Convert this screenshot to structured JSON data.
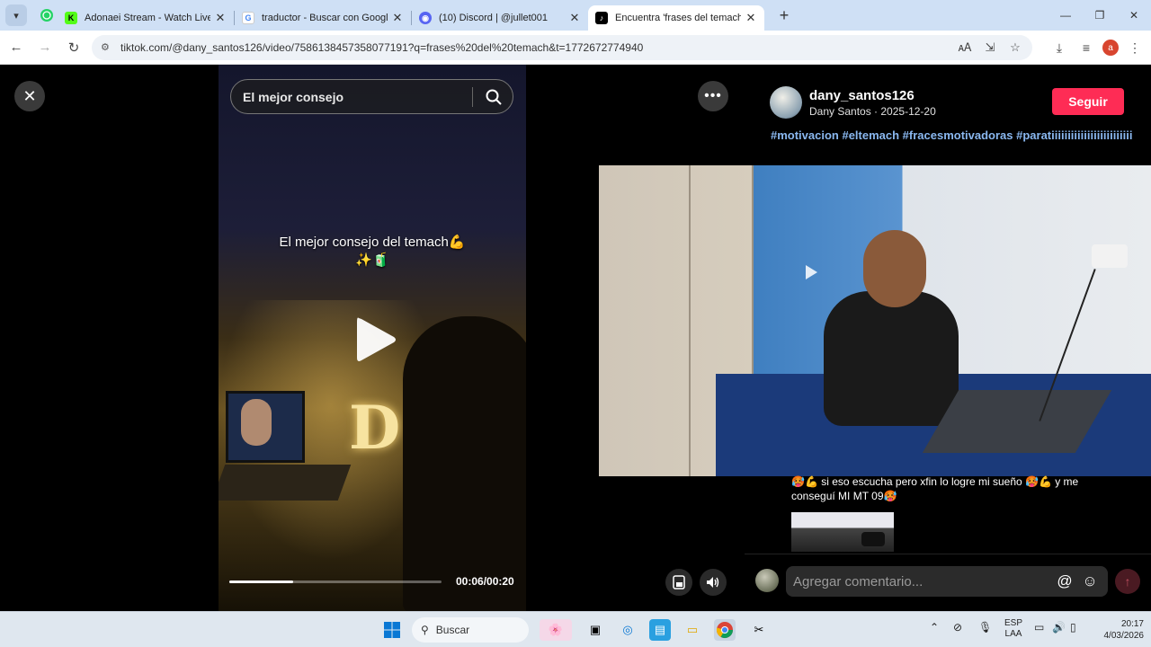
{
  "browser": {
    "tabs": [
      {
        "title": "Adonaei Stream - Watch Live o",
        "favicon": "kick-icon",
        "color": "#53fc18",
        "active": false
      },
      {
        "title": "traductor - Buscar con Google",
        "favicon": "google-icon",
        "color": "#4285f4",
        "active": false
      },
      {
        "title": "(10) Discord | @jullet001",
        "favicon": "discord-icon",
        "color": "#5865f2",
        "active": false
      },
      {
        "title": "Encuentra 'frases del temach' e",
        "favicon": "tiktok-icon",
        "color": "#000000",
        "active": true
      }
    ],
    "url": "tiktok.com/@dany_santos126/video/7586138457358077191?q=frases%20del%20temach&t=1772672774940"
  },
  "video": {
    "search_value": "El mejor consejo",
    "caption": "El mejor consejo del temach💪✨🧃",
    "time": "00:06/00:20",
    "progress": 0.3
  },
  "post": {
    "handle": "dany_santos126",
    "subline": "Dany Santos · 2025-12-20",
    "follow_label": "Seguir",
    "hashtags": "#motivacion #eltemach #fracesmotivadoras #paratiiiiiiiiiiiiiiiiiiiiiiiii",
    "accent": "#fe2c55"
  },
  "comments": {
    "item_text": "🥵💪 si eso escucha pero xfin lo logre mi sueño 🥵💪 y me conseguí MI MT 09🥵",
    "input_placeholder": "Agregar comentario..."
  },
  "taskbar": {
    "search_label": "Buscar",
    "lang_line1": "ESP",
    "lang_line2": "LAA",
    "time": "20:17",
    "date": "4/03/2026"
  }
}
